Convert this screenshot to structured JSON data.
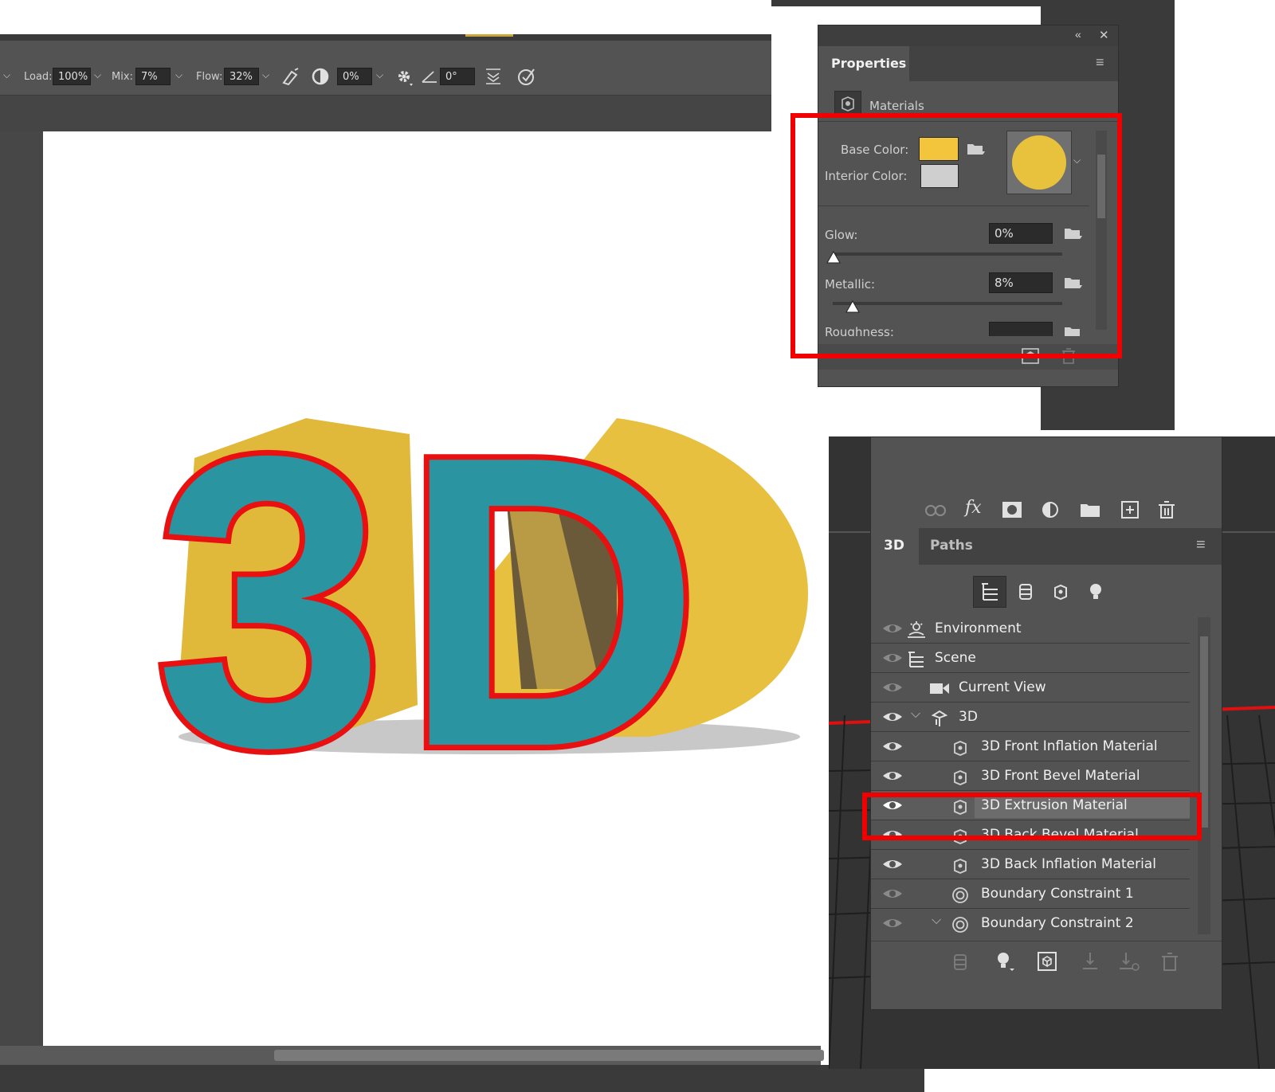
{
  "toolbar": {
    "load_label": "Load:",
    "load_value": "100%",
    "mix_label": "Mix:",
    "mix_value": "7%",
    "flow_label": "Flow:",
    "flow_value": "32%",
    "smoothing_value": "0%",
    "angle_value": "0°"
  },
  "properties": {
    "title": "Properties",
    "section": "Materials",
    "base_color_label": "Base Color:",
    "interior_color_label": "Interior Color:",
    "base_color": "#f2c53d",
    "interior_color": "#cfcfcf",
    "glow_label": "Glow:",
    "glow_value": "0%",
    "glow_level": 0,
    "metallic_label": "Metallic:",
    "metallic_value": "8%",
    "metallic_level": 0.08,
    "roughness_label": "Roughness:"
  },
  "panel3d": {
    "tab_3d": "3D",
    "tab_paths": "Paths",
    "layers": [
      {
        "label": "Environment",
        "icon": "environment-icon"
      },
      {
        "label": "Scene",
        "icon": "scene-icon"
      },
      {
        "label": "Current View",
        "icon": "camera-icon"
      },
      {
        "label": "3D",
        "icon": "mesh-icon"
      },
      {
        "label": "3D Front Inflation Material",
        "icon": "material-icon"
      },
      {
        "label": "3D Front Bevel Material",
        "icon": "material-icon"
      },
      {
        "label": "3D Extrusion Material",
        "icon": "material-icon",
        "selected": true
      },
      {
        "label": "3D Back Bevel Material",
        "icon": "material-icon"
      },
      {
        "label": "3D Back Inflation Material",
        "icon": "material-icon"
      },
      {
        "label": "Boundary Constraint 1",
        "icon": "constraint-icon"
      },
      {
        "label": "Boundary Constraint 2",
        "icon": "constraint-icon"
      }
    ]
  },
  "canvas": {
    "art_text": "3D",
    "face_color": "#2a94a0",
    "outline_color": "#e81010",
    "extrusion_color": "#e8c040"
  },
  "colors": {
    "highlight": "#f00000",
    "panel_bg": "#535353",
    "ui_dark": "#3c3c3c"
  }
}
